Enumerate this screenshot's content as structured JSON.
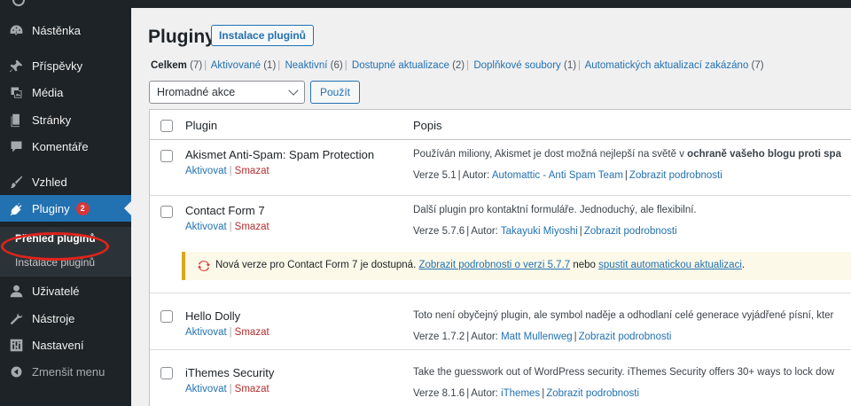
{
  "sidebar": {
    "items": [
      {
        "label": "Nástěnka",
        "icon": "dashboard-icon"
      },
      {
        "label": "Příspěvky",
        "icon": "pin-icon"
      },
      {
        "label": "Média",
        "icon": "media-icon"
      },
      {
        "label": "Stránky",
        "icon": "page-icon"
      },
      {
        "label": "Komentáře",
        "icon": "comment-icon"
      },
      {
        "label": "Vzhled",
        "icon": "brush-icon"
      },
      {
        "label": "Pluginy",
        "icon": "plugin-icon",
        "badge": "2"
      },
      {
        "label": "Uživatelé",
        "icon": "user-icon"
      },
      {
        "label": "Nástroje",
        "icon": "wrench-icon"
      },
      {
        "label": "Nastavení",
        "icon": "settings-icon"
      },
      {
        "label": "Zmenšit menu",
        "icon": "collapse-icon"
      }
    ],
    "submenu": [
      "Přehled pluginů",
      "Instalace pluginů"
    ]
  },
  "header": {
    "title": "Pluginy",
    "add_new": "Instalace pluginů"
  },
  "filters": [
    {
      "label": "Celkem",
      "count": "(7)"
    },
    {
      "label": "Aktivované",
      "count": "(1)"
    },
    {
      "label": "Neaktivní",
      "count": "(6)"
    },
    {
      "label": "Dostupné aktualizace",
      "count": "(2)"
    },
    {
      "label": "Doplňkové soubory",
      "count": "(1)"
    },
    {
      "label": "Automatických aktualizací zakázáno",
      "count": "(7)"
    }
  ],
  "bulk": {
    "selected": "Hromadné akce",
    "apply": "Použít"
  },
  "table": {
    "col_plugin": "Plugin",
    "col_desc": "Popis",
    "activate": "Aktivovat",
    "delete": "Smazat",
    "by": "Autor:",
    "details": "Zobrazit podrobnosti",
    "rows": [
      {
        "name": "Akismet Anti-Spam: Spam Protection",
        "desc": "Používán miliony, Akismet je dost možná nejlepší na světě v ",
        "desc_bold": "ochraně vašeho blogu proti spa",
        "version": "Verze 5.1",
        "author": "Automattic - Anti Spam Team"
      },
      {
        "name": "Contact Form 7",
        "desc": "Další plugin pro kontaktní formuláře. Jednoduchý, ale flexibilní.",
        "desc_bold": "",
        "version": "Verze 5.7.6",
        "author": "Takayuki Miyoshi"
      },
      {
        "name": "Hello Dolly",
        "desc": "Toto není obyčejný plugin, ale symbol naděje a odhodlaní celé generace vyjádřené písní, kter",
        "desc_bold": "",
        "version": "Verze 1.7.2",
        "author": "Matt Mullenweg"
      },
      {
        "name": "iThemes Security",
        "desc": "Take the guesswork out of WordPress security. iThemes Security offers 30+ ways to lock dow",
        "desc_bold": "",
        "version": "Verze 8.1.6",
        "author": "iThemes"
      }
    ]
  },
  "notice": {
    "text": "Nová verze pro Contact Form 7 je dostupná. ",
    "link1": "Zobrazit podrobnosti o verzi 5.7.7",
    "mid": " nebo ",
    "link2": "spustit automatickou aktualizaci",
    "end": "."
  },
  "colors": {
    "accent": "#2271b1",
    "sidebar_bg": "#1d2327",
    "highlight": "#e0231b",
    "badge": "#d63638",
    "notice_border": "#dba617"
  }
}
